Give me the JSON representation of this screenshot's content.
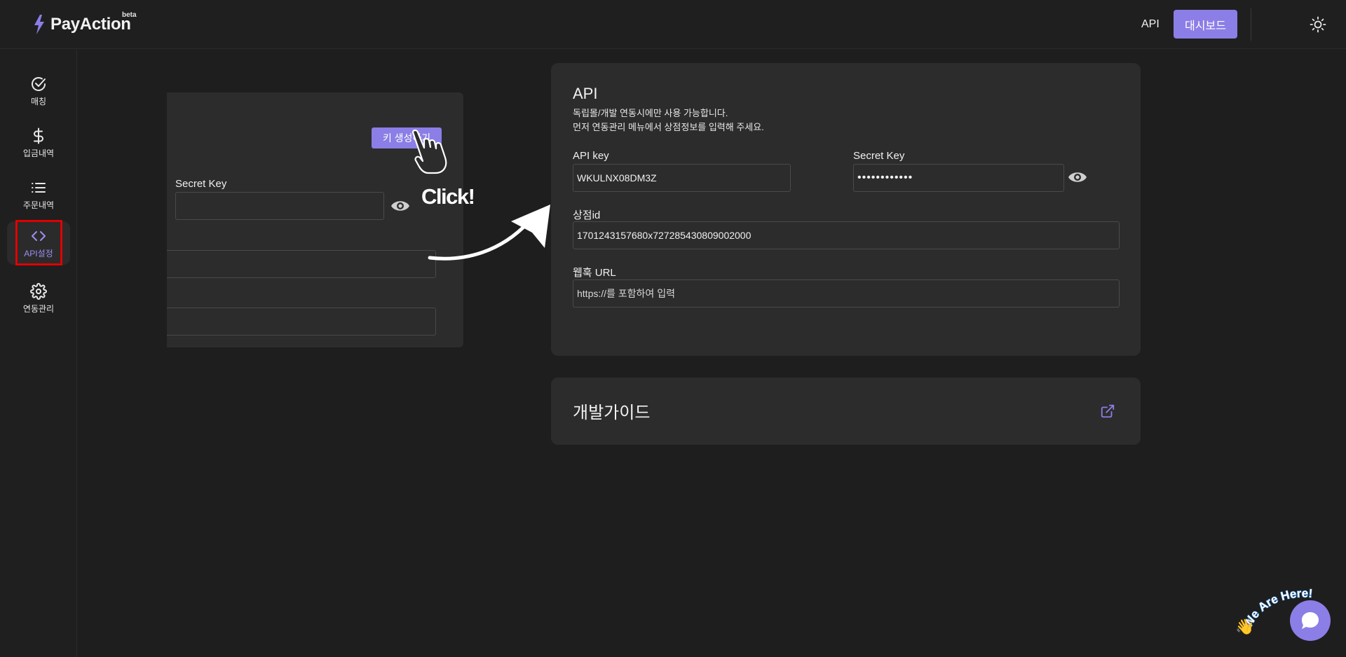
{
  "header": {
    "logo_text": "PayAction",
    "logo_badge": "beta",
    "nav_api": "API",
    "dashboard_button": "대시보드",
    "theme_icon": "sun-icon"
  },
  "sidebar": {
    "items": [
      {
        "label": "매칭",
        "icon": "check-circle-icon"
      },
      {
        "label": "입금내역",
        "icon": "dollar-icon"
      },
      {
        "label": "주문내역",
        "icon": "list-icon"
      },
      {
        "label": "API설정",
        "icon": "code-icon",
        "active": true
      },
      {
        "label": "연동관리",
        "icon": "gear-icon"
      }
    ]
  },
  "illustration": {
    "key_button": "키 생성하기",
    "secret_label": "Secret Key",
    "click_text": "Click!"
  },
  "api_card": {
    "title": "API",
    "desc_line1": "독립몰/개발 연동시에만 사용 가능합니다.",
    "desc_line2": "먼저 연동관리 메뉴에서 상점정보를 입력해 주세요.",
    "api_key_label": "API key",
    "api_key_value": "WKULNX08DM3Z",
    "secret_key_label": "Secret Key",
    "secret_key_value": "••••••••••••",
    "store_id_label": "상점id",
    "store_id_value": "1701243157680x727285430809002000",
    "webhook_label": "웹훅 URL",
    "webhook_placeholder": "https://를 포함하여 입력"
  },
  "guide_card": {
    "title": "개발가이드",
    "icon": "external-link-icon"
  },
  "chat": {
    "badge_text": "We Are Here!",
    "icon": "chat-bubble-icon"
  },
  "colors": {
    "accent": "#8b7ee6",
    "background": "#1e1e1e",
    "card": "#2c2c2c",
    "highlight": "#e00000"
  }
}
